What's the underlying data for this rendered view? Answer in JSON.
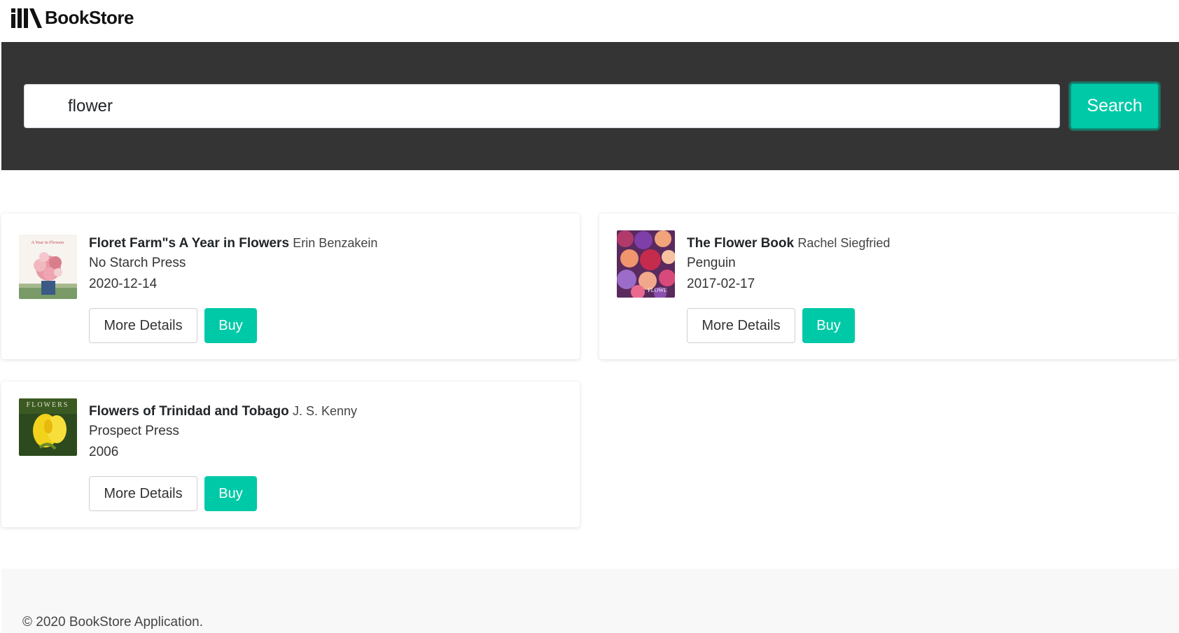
{
  "brand": {
    "name": "BookStore",
    "logo_icon": "book-logo-icon"
  },
  "search": {
    "query": "flower",
    "button_label": "Search"
  },
  "results": [
    {
      "title": "Floret Farm\"s A Year in Flowers",
      "author": "Erin Benzakein",
      "publisher": "No Starch Press",
      "date": "2020-12-14",
      "cover_caption": "A Year in Flowers",
      "more_label": "More Details",
      "buy_label": "Buy"
    },
    {
      "title": "The Flower Book",
      "author": "Rachel Siegfried",
      "publisher": "Penguin",
      "date": "2017-02-17",
      "cover_caption": "FLOWE",
      "more_label": "More Details",
      "buy_label": "Buy"
    },
    {
      "title": "Flowers of Trinidad and Tobago",
      "author": "J. S. Kenny",
      "publisher": "Prospect Press",
      "date": "2006",
      "cover_caption": "FLOWERS",
      "more_label": "More Details",
      "buy_label": "Buy"
    }
  ],
  "footer": {
    "text": "© 2020 BookStore Application."
  },
  "colors": {
    "accent": "#00c9a7",
    "band": "#343434",
    "footer_bg": "#f8f8f8"
  }
}
